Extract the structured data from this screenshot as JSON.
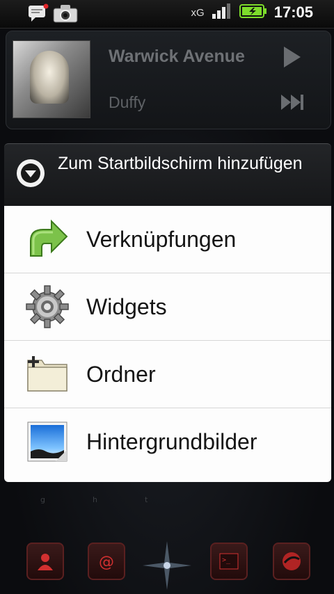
{
  "status_bar": {
    "network_label": "xG",
    "time": "17:05"
  },
  "music_widget": {
    "track_title": "Warwick Avenue",
    "artist": "Duffy"
  },
  "dialog": {
    "title": "Zum Startbildschirm hinzufügen",
    "items": [
      {
        "label": "Verknüpfungen",
        "icon": "shortcut-arrow-icon"
      },
      {
        "label": "Widgets",
        "icon": "gear-icon"
      },
      {
        "label": "Ordner",
        "icon": "folder-icon"
      },
      {
        "label": "Hintergrundbilder",
        "icon": "wallpaper-icon"
      }
    ]
  },
  "dock": {
    "icons": [
      "contacts-icon",
      "email-icon",
      "launcher-icon",
      "terminal-icon",
      "browser-icon"
    ]
  },
  "colors": {
    "dialog_header": "#222428",
    "dialog_list": "#fdfdfd",
    "accent_green": "#7cc24a",
    "dock_red": "#c0282a"
  }
}
